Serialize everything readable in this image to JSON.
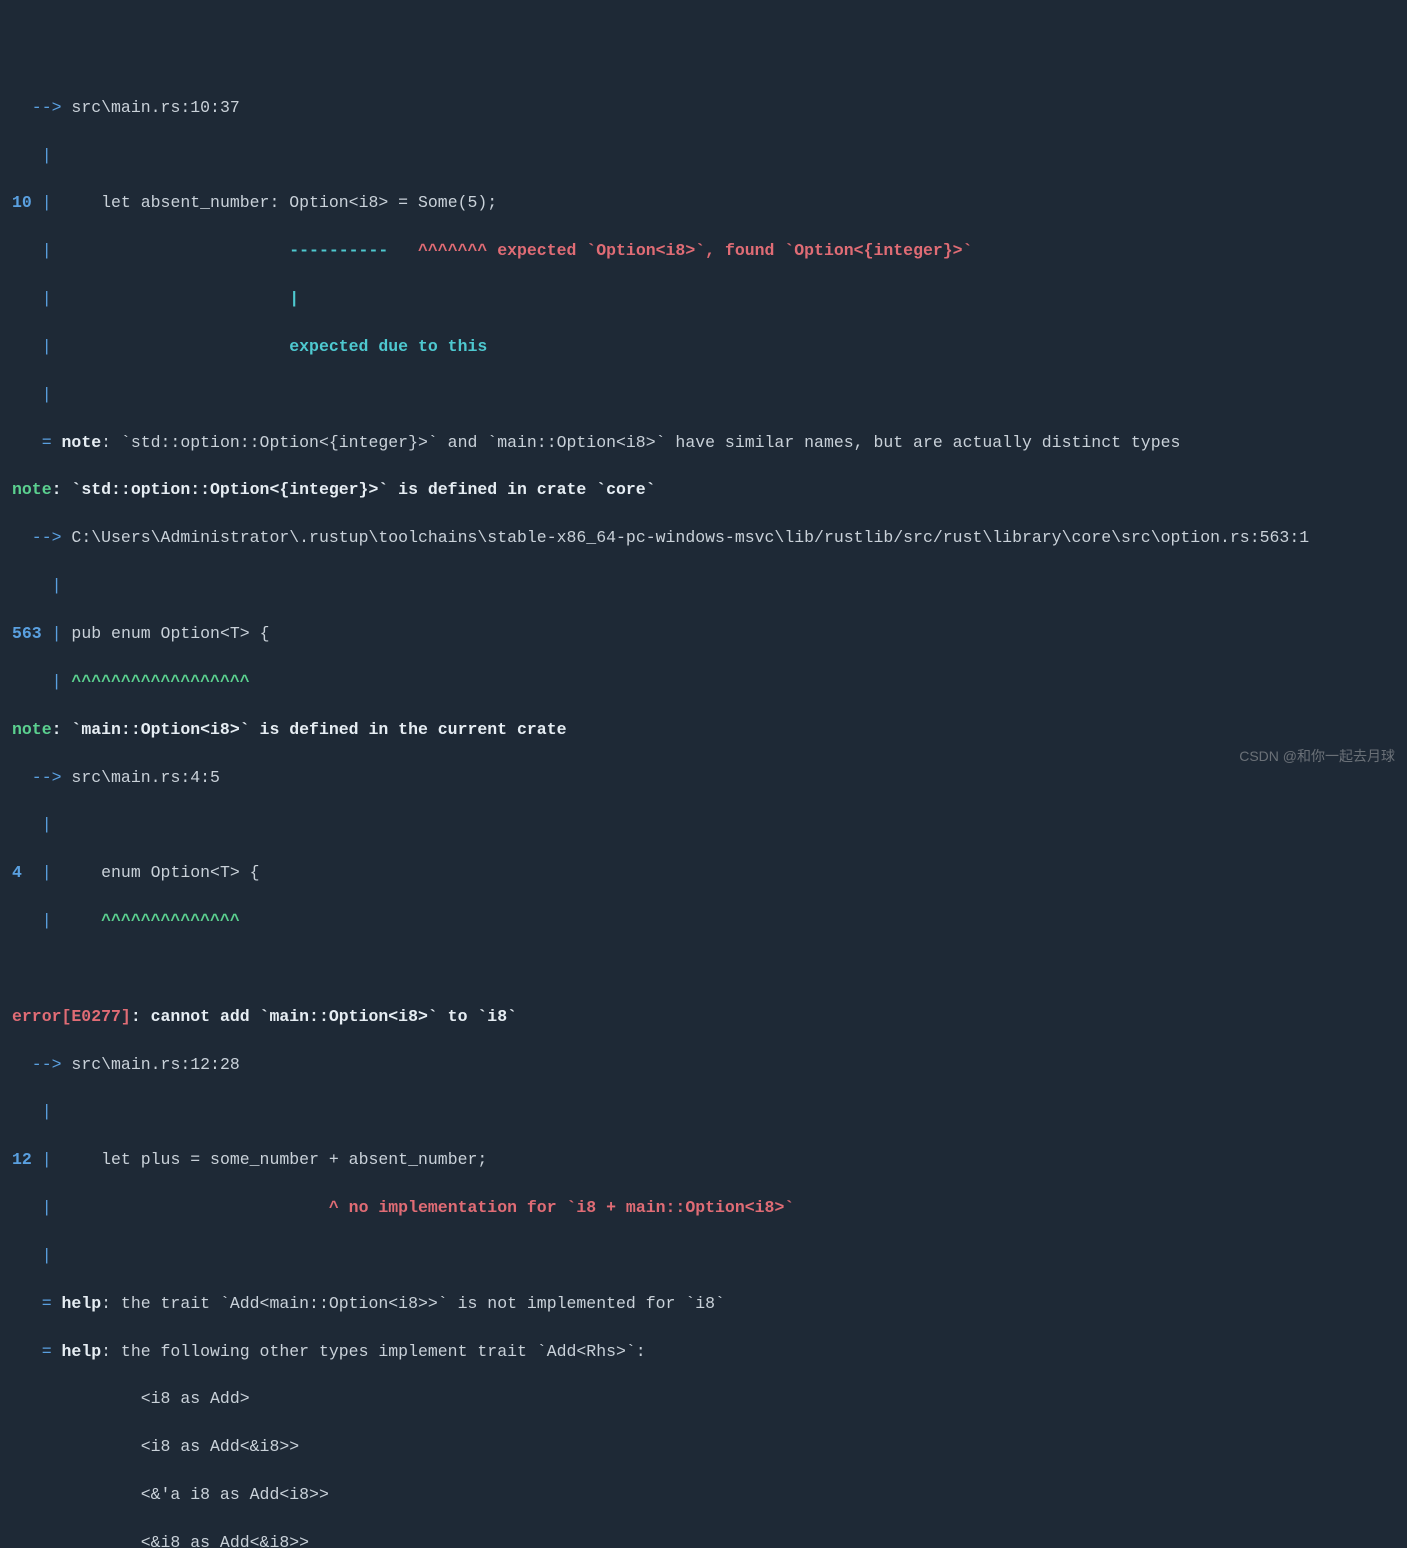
{
  "top_arrow": "  --> ",
  "top_loc": "src\\main.rs:10:37",
  "top_pipe": "   |",
  "ln10": "10",
  "ln10_pipe": " |",
  "ln10_code": "     let absent_number: Option<i8> = Some(5);",
  "ln10_mark_pad": "   |                        ",
  "ln10_dash": "----------   ",
  "ln10_caret": "^^^^^^^ ",
  "ln10_err": "expected `Option<i8>`, found `Option<{integer}>`",
  "ln10_bar_pad": "   |                        ",
  "ln10_bar": "|",
  "ln10_exp_pad": "   |                        ",
  "ln10_exp": "expected due to this",
  "note_eq": "   = ",
  "note1_label": "note",
  "note1_text": ": `std::option::Option<{integer}>` and `main::Option<i8>` have similar names, but are actually distinct types",
  "note2_label": "note",
  "note2_text": ": `std::option::Option<{integer}>` is defined in crate `core`",
  "note2_arrow": "  --> ",
  "note2_loc": "C:\\Users\\Administrator\\.rustup\\toolchains\\stable-x86_64-pc-windows-msvc\\lib/rustlib/src/rust\\library\\core\\src\\option.rs:563:1",
  "pipe_indent": "    |",
  "ln563": "563",
  "ln563_pipe": " |",
  "ln563_code": " pub enum Option<T> {",
  "ln563_caret_pad": "    |",
  "ln563_caret": " ^^^^^^^^^^^^^^^^^^",
  "note3_label": "note",
  "note3_text": ": `main::Option<i8>` is defined in the current crate",
  "note3_arrow": "  --> ",
  "note3_loc": "src\\main.rs:4:5",
  "ln4": "4",
  "ln4_pipe": "  |",
  "ln4_code": "     enum Option<T> {",
  "ln4_caret_pad": "   |",
  "ln4_caret": "     ^^^^^^^^^^^^^^",
  "err2_label": "error[E0277]",
  "err2_text": ": cannot add `main::Option<i8>` to `i8`",
  "err2_arrow": "  --> ",
  "err2_loc": "src\\main.rs:12:28",
  "ln12": "12",
  "ln12_pipe": " |",
  "ln12_code": "     let plus = some_number + absent_number;",
  "ln12_caret_pad": "   |                            ",
  "ln12_caret": "^ ",
  "ln12_err": "no implementation for `i8 + main::Option<i8>`",
  "help1_eq": "   = ",
  "help1_label": "help",
  "help1_text": ": the trait `Add<main::Option<i8>>` is not implemented for `i8`",
  "help2_label": "help",
  "help2_text": ": the following other types implement trait `Add<Rhs>`:",
  "impl1": "             <i8 as Add>",
  "impl2": "             <i8 as Add<&i8>>",
  "impl3": "             <&'a i8 as Add<i8>>",
  "impl4": "             <&i8 as Add<&i8>>",
  "watermark": "CSDN @和你一起去月球"
}
